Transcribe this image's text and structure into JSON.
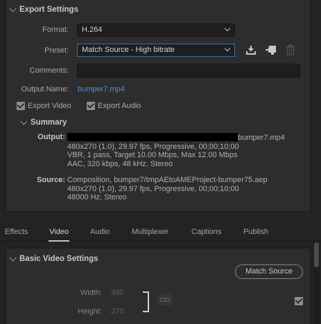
{
  "export_settings": {
    "title": "Export Settings",
    "format_label": "Format:",
    "format_value": "H.264",
    "preset_label": "Preset:",
    "preset_value": "Match Source - High bitrate",
    "comments_label": "Comments:",
    "comments_value": "",
    "output_name_label": "Output Name:",
    "output_name_value": "bumper7.mp4",
    "export_video_label": "Export Video",
    "export_video_checked": true,
    "export_audio_label": "Export Audio",
    "export_audio_checked": true
  },
  "summary": {
    "title": "Summary",
    "output_label": "Output:",
    "output_filename": "bumper7.mp4",
    "output_lines": [
      "480x270 (1.0), 29.97 fps, Progressive, 00;00;10;00",
      "VBR, 1 pass, Target 10.00 Mbps, Max 12.00 Mbps",
      "AAC, 320 kbps, 48 kHz, Stereo"
    ],
    "source_label": "Source:",
    "source_lines": [
      "Composition, bumper7/tmpAEtoAMEProject-bumper75.aep",
      "480x270 (1.0), 29.97 fps, Progressive, 00;00;10;00",
      "48000 Hz, Stereo"
    ]
  },
  "tabs": [
    {
      "label": "Effects",
      "active": false
    },
    {
      "label": "Video",
      "active": true
    },
    {
      "label": "Audio",
      "active": false
    },
    {
      "label": "Multiplexer",
      "active": false
    },
    {
      "label": "Captions",
      "active": false
    },
    {
      "label": "Publish",
      "active": false
    }
  ],
  "basic_video": {
    "title": "Basic Video Settings",
    "match_source_label": "Match Source",
    "width_label": "Width:",
    "width_value": "480",
    "height_label": "Height:",
    "height_value": "270",
    "checkbox_checked": true
  },
  "icons": {
    "save_preset": "download-icon",
    "import_preset": "import-icon",
    "delete_preset": "trash-icon",
    "link": "chain-link-icon"
  }
}
